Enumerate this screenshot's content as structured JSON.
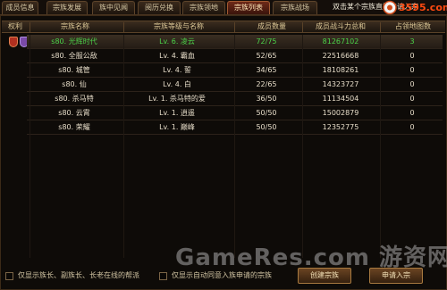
{
  "tabs": [
    "成员信息",
    "宗族发展",
    "族中见闻",
    "阅历兑换",
    "宗族领地",
    "宗族列表",
    "宗族战场"
  ],
  "active_tab": "宗族列表",
  "tip_text": "双击某个宗族直接申请入宗",
  "logo_text": "3595.com",
  "columns": [
    "权利",
    "宗族名称",
    "宗族等级与名称",
    "成员数量",
    "成员战斗力总和",
    "占领地图数"
  ],
  "rows": [
    {
      "name": "s80. 光辉时代",
      "level": "Lv. 6. 凌云",
      "members": "72/75",
      "power": "81267102",
      "maps": "3"
    },
    {
      "name": "s80. 全服公敌",
      "level": "Lv. 4. 霸血",
      "members": "52/65",
      "power": "22516668",
      "maps": "0"
    },
    {
      "name": "s80. 城管",
      "level": "Lv. 4. 誓",
      "members": "34/65",
      "power": "18108261",
      "maps": "0"
    },
    {
      "name": "s80. 仙",
      "level": "Lv. 4. 白",
      "members": "22/65",
      "power": "14323727",
      "maps": "0"
    },
    {
      "name": "s80. 杀马特",
      "level": "Lv. 1. 杀马特的爱",
      "members": "36/50",
      "power": "11134504",
      "maps": "0"
    },
    {
      "name": "s80. 云霄",
      "level": "Lv. 1. 逍遥",
      "members": "50/50",
      "power": "15002879",
      "maps": "0"
    },
    {
      "name": "s80. 荣耀",
      "level": "Lv. 1. 巅峰",
      "members": "50/50",
      "power": "12352775",
      "maps": "0"
    }
  ],
  "footer": {
    "check1": "仅显示族长、副族长、长老在线的帮派",
    "check2": "仅显示自动同意入族申请的宗族",
    "create_btn": "创建宗族",
    "apply_btn": "申请入宗"
  },
  "watermark": "GameRes.com 游资网",
  "colors": {
    "active_tab": "#6e2a18",
    "selected_row_text": "#4cd34a",
    "badge_red": "#b03020",
    "badge_purple": "#7a4aa8"
  }
}
